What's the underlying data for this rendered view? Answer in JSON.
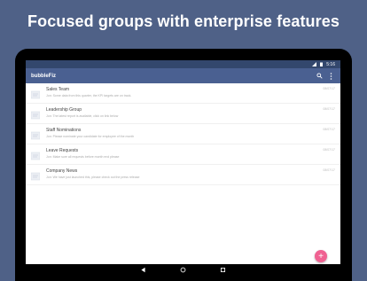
{
  "headline": "Focused groups with enterprise features",
  "status_bar": {
    "time": "5:16"
  },
  "app_bar": {
    "title": "bubbleFiz",
    "search_icon": "search-icon",
    "menu_icon": "more-vert-icon"
  },
  "conversations": [
    {
      "name": "Sales Team",
      "preview": "Jon: Some data from this quarter, the KPI targets are on track.",
      "time": "08/07/17"
    },
    {
      "name": "Leadership Group",
      "preview": "Jon: The latest report is available, click on link below",
      "time": "08/07/17"
    },
    {
      "name": "Staff Nominations",
      "preview": "Jon: Please nominate your candidate for employee of the month",
      "time": "08/07/17"
    },
    {
      "name": "Leave Requests",
      "preview": "Jon: Make sure all requests before month end please",
      "time": "08/07/17"
    },
    {
      "name": "Company News",
      "preview": "Jon: We have just launched this, please check out the press release",
      "time": "08/07/17"
    }
  ],
  "fab": {
    "label": "+"
  },
  "colors": {
    "background": "#4f6187",
    "app_bar": "#4a6091",
    "status_bar": "#33476d",
    "fab": "#f06292"
  }
}
